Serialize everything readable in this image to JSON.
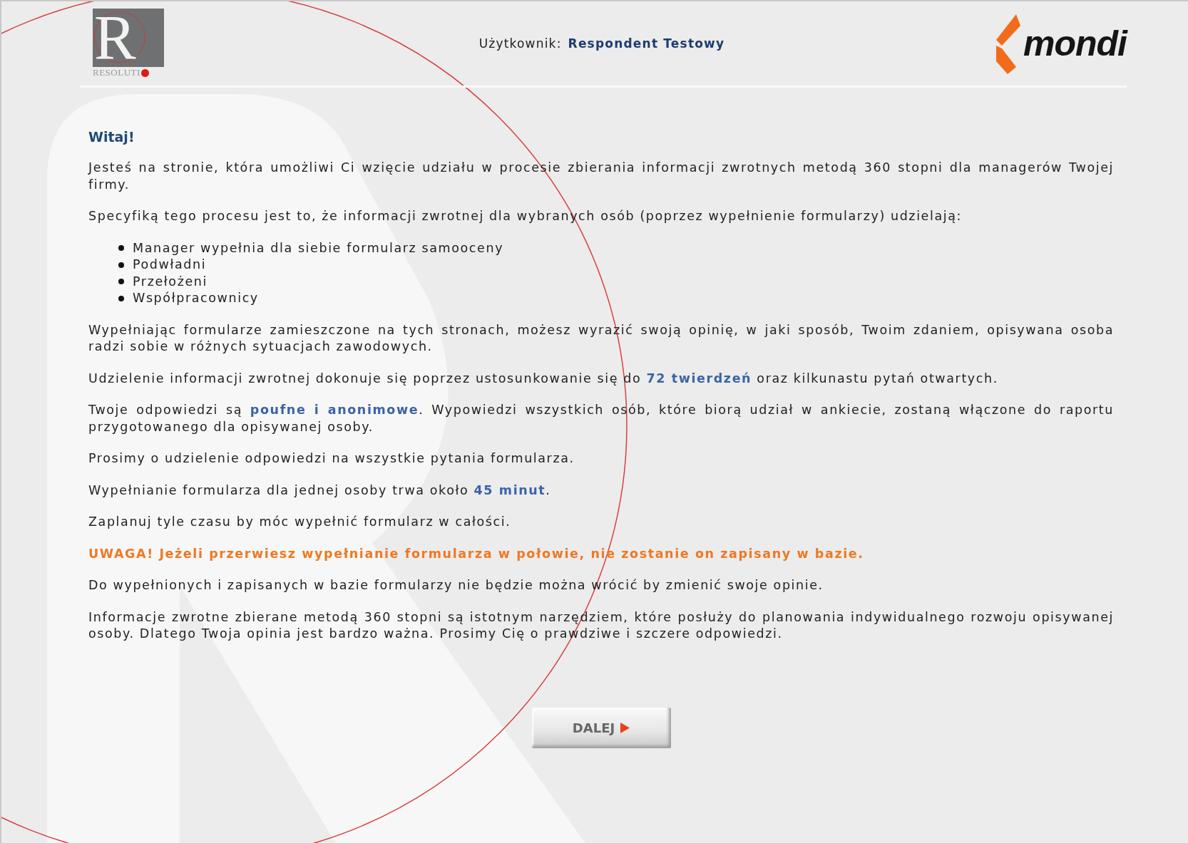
{
  "header": {
    "left_logo": {
      "letter": "R",
      "wordmark": "RESOLUTI"
    },
    "user_label": "Użytkownik:",
    "user_name": "Respondent Testowy",
    "right_logo": {
      "wordmark": "mondi"
    }
  },
  "heading": "Witaj!",
  "blocks": [
    {
      "kind": "text",
      "text": "Jesteś na stronie, która umożliwi Ci wzięcie udziału w procesie zbierania informacji zwrotnych metodą 360 stopni dla managerów Twojej firmy."
    },
    {
      "kind": "text",
      "text": "Specyfiką tego procesu jest to, że informacji zwrotnej dla wybranych osób (poprzez wypełnienie formularzy) udzielają:"
    },
    {
      "kind": "list",
      "items": [
        "Manager wypełnia dla siebie formularz samooceny",
        "Podwładni",
        "Przełożeni",
        "Współpracownicy"
      ]
    },
    {
      "kind": "text",
      "text": "Wypełniając formularze zamieszczone na tych stronach, możesz wyrazić swoją opinię, w jaki sposób, Twoim zdaniem, opisywana osoba radzi sobie w różnych sytuacjach zawodowych."
    },
    {
      "kind": "text",
      "text": "Udzielenie informacji zwrotnej dokonuje się poprzez ustosunkowanie się do **72 twierdzeń** oraz kilkunastu pytań otwartych."
    },
    {
      "kind": "text",
      "text": "Twoje odpowiedzi są **poufne i anonimowe**. Wypowiedzi wszystkich osób, które biorą udział w ankiecie, zostaną włączone do raportu przygotowanego dla opisywanej osoby."
    },
    {
      "kind": "text",
      "text": "Prosimy o udzielenie odpowiedzi na wszystkie pytania formularza."
    },
    {
      "kind": "text",
      "text": "Wypełnianie formularza dla jednej osoby trwa około **45 minut**."
    },
    {
      "kind": "text",
      "text": "Zaplanuj tyle czasu by móc wypełnić formularz w całości."
    },
    {
      "kind": "warning",
      "text": "UWAGA! Jeżeli przerwiesz wypełnianie formularza w połowie, nie zostanie on zapisany w bazie."
    },
    {
      "kind": "text",
      "text": "Do wypełnionych i zapisanych w bazie formularzy nie będzie można wrócić by zmienić swoje opinie."
    },
    {
      "kind": "text",
      "text": "Informacje zwrotne zbierane metodą 360 stopni są istotnym narzędziem, które posłuży do planowania indywidualnego rozwoju opisywanej osoby. Dlatego Twoja opinia jest bardzo ważna. Prosimy Cię o prawdziwe i szczere odpowiedzi."
    }
  ],
  "next_button": {
    "label": "DALEJ"
  }
}
